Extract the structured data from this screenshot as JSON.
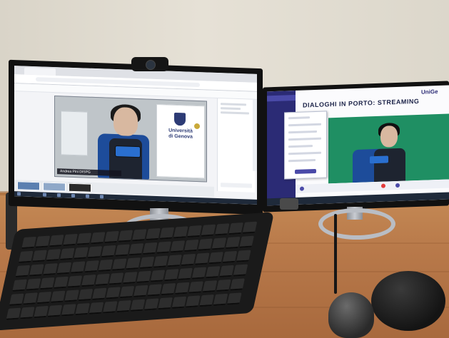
{
  "scene": {
    "description_label": "photo-of-dual-monitor-desk-setup"
  },
  "left_monitor": {
    "university_logo_line1": "Università",
    "university_logo_line2": "di Genova",
    "participant_name": "Andrea Pini DISPG"
  },
  "right_monitor": {
    "banner_title": "DIALOGHI IN PORTO: STREAMING",
    "brand_text": "UniGe"
  },
  "colors": {
    "desk": "#b8794a",
    "wall": "#e2ddd2",
    "green_screen": "#1f8f63",
    "chair_blue": "#1d4c9a",
    "university_blue": "#2d3b75"
  }
}
